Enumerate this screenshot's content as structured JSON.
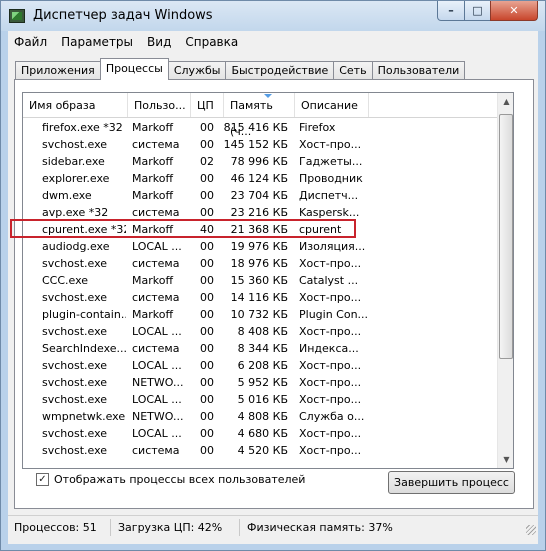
{
  "window": {
    "title": "Диспетчер задач Windows",
    "min_label": "–",
    "max_label": "□",
    "close_label": "✕"
  },
  "menu": [
    "Файл",
    "Параметры",
    "Вид",
    "Справка"
  ],
  "tabs": [
    {
      "label": "Приложения",
      "active": false
    },
    {
      "label": "Процессы",
      "active": true
    },
    {
      "label": "Службы",
      "active": false
    },
    {
      "label": "Быстродействие",
      "active": false
    },
    {
      "label": "Сеть",
      "active": false
    },
    {
      "label": "Пользователи",
      "active": false
    }
  ],
  "columns": {
    "name": "Имя образа",
    "user": "Пользо...",
    "cpu": "ЦП",
    "mem": "Память (ч...",
    "desc": "Описание"
  },
  "processes": [
    {
      "name": "firefox.exe *32",
      "user": "Markoff",
      "cpu": "00",
      "mem": "815 416 КБ",
      "desc": "Firefox"
    },
    {
      "name": "svchost.exe",
      "user": "система",
      "cpu": "00",
      "mem": "145 152 КБ",
      "desc": "Хост-про..."
    },
    {
      "name": "sidebar.exe",
      "user": "Markoff",
      "cpu": "02",
      "mem": "78 996 КБ",
      "desc": "Гаджеты..."
    },
    {
      "name": "explorer.exe",
      "user": "Markoff",
      "cpu": "00",
      "mem": "46 124 КБ",
      "desc": "Проводник"
    },
    {
      "name": "dwm.exe",
      "user": "Markoff",
      "cpu": "00",
      "mem": "23 704 КБ",
      "desc": "Диспетч..."
    },
    {
      "name": "avp.exe *32",
      "user": "система",
      "cpu": "00",
      "mem": "23 216 КБ",
      "desc": "Kaspersk..."
    },
    {
      "name": "cpurent.exe *32",
      "user": "Markoff",
      "cpu": "40",
      "mem": "21 368 КБ",
      "desc": "cpurent"
    },
    {
      "name": "audiodg.exe",
      "user": "LOCAL ...",
      "cpu": "00",
      "mem": "19 976 КБ",
      "desc": "Изоляция..."
    },
    {
      "name": "svchost.exe",
      "user": "система",
      "cpu": "00",
      "mem": "18 976 КБ",
      "desc": "Хост-про..."
    },
    {
      "name": "CCC.exe",
      "user": "Markoff",
      "cpu": "00",
      "mem": "15 360 КБ",
      "desc": "Catalyst ..."
    },
    {
      "name": "svchost.exe",
      "user": "система",
      "cpu": "00",
      "mem": "14 116 КБ",
      "desc": "Хост-про..."
    },
    {
      "name": "plugin-contain...",
      "user": "Markoff",
      "cpu": "00",
      "mem": "10 732 КБ",
      "desc": "Plugin Con..."
    },
    {
      "name": "svchost.exe",
      "user": "LOCAL ...",
      "cpu": "00",
      "mem": "8 408 КБ",
      "desc": "Хост-про..."
    },
    {
      "name": "SearchIndexe...",
      "user": "система",
      "cpu": "00",
      "mem": "8 344 КБ",
      "desc": "Индекса..."
    },
    {
      "name": "svchost.exe",
      "user": "LOCAL ...",
      "cpu": "00",
      "mem": "6 208 КБ",
      "desc": "Хост-про..."
    },
    {
      "name": "svchost.exe",
      "user": "NETWO...",
      "cpu": "00",
      "mem": "5 952 КБ",
      "desc": "Хост-про..."
    },
    {
      "name": "svchost.exe",
      "user": "LOCAL ...",
      "cpu": "00",
      "mem": "5 016 КБ",
      "desc": "Хост-про..."
    },
    {
      "name": "wmpnetwk.exe",
      "user": "NETWO...",
      "cpu": "00",
      "mem": "4 808 КБ",
      "desc": "Служба о..."
    },
    {
      "name": "svchost.exe",
      "user": "LOCAL ...",
      "cpu": "00",
      "mem": "4 680 КБ",
      "desc": "Хост-про..."
    },
    {
      "name": "svchost.exe",
      "user": "система",
      "cpu": "00",
      "mem": "4 520 КБ",
      "desc": "Хост-про..."
    }
  ],
  "highlighted_process": "cpurent.exe *32",
  "show_all_users": {
    "label": "Отображать процессы всех пользователей",
    "checked": true
  },
  "end_process_button": "Завершить процесс",
  "status": {
    "processes": "Процессов: 51",
    "cpu": "Загрузка ЦП: 42%",
    "memory": "Физическая память: 37%"
  },
  "colors": {
    "highlight_border": "#c8232c",
    "title_bg": "#c2d7ec",
    "close_bg": "#c8462c"
  }
}
